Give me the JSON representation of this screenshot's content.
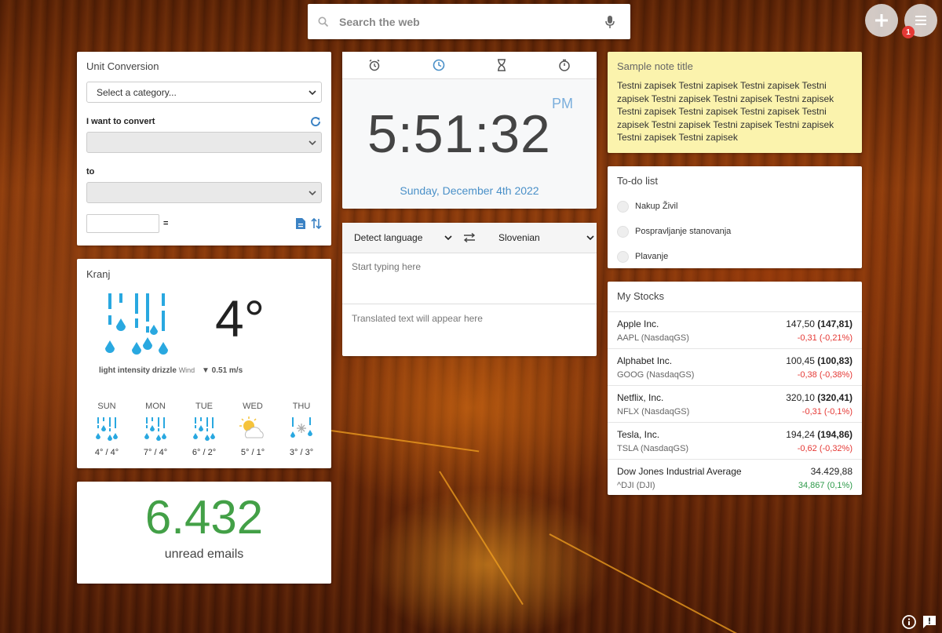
{
  "search": {
    "placeholder": "Search the web"
  },
  "header": {
    "notification_count": "1"
  },
  "unit_conversion": {
    "title": "Unit Conversion",
    "category_placeholder": "Select a category...",
    "convert_label": "I want to convert",
    "to_label": "to",
    "equals": "="
  },
  "weather": {
    "location": "Kranj",
    "temperature": "4°",
    "condition": "light intensity drizzle",
    "wind_label": "Wind",
    "wind_value": "0.51 m/s",
    "forecast": [
      {
        "day": "SUN",
        "temps": "4° / 4°",
        "icon": "rain-icon"
      },
      {
        "day": "MON",
        "temps": "7° / 4°",
        "icon": "rain-icon"
      },
      {
        "day": "TUE",
        "temps": "6° / 2°",
        "icon": "rain-icon"
      },
      {
        "day": "WED",
        "temps": "5° / 1°",
        "icon": "partly-sunny-icon"
      },
      {
        "day": "THU",
        "temps": "3° / 3°",
        "icon": "sleet-icon"
      }
    ]
  },
  "emails": {
    "count": "6.432",
    "label": "unread emails"
  },
  "clock": {
    "time": "5:51:32",
    "ampm": "PM",
    "date": "Sunday, December 4th 2022",
    "tabs": [
      "alarm-icon",
      "clock-icon",
      "hourglass-icon",
      "stopwatch-icon"
    ]
  },
  "translate": {
    "source_lang": "Detect language",
    "target_lang": "Slovenian",
    "input_placeholder": "Start typing here",
    "output_placeholder": "Translated text will appear here"
  },
  "note": {
    "title": "Sample note title",
    "body": "Testni zapisek Testni zapisek Testni zapisek Testni zapisek Testni zapisek Testni zapisek Testni zapisek Testni zapisek Testni zapisek Testni zapisek Testni zapisek Testni zapisek Testni zapisek Testni zapisek Testni zapisek Testni zapisek"
  },
  "todo": {
    "title": "To-do list",
    "items": [
      "Nakup Živil",
      "Pospravljanje stanovanja",
      "Plavanje"
    ]
  },
  "stocks": {
    "title": "My Stocks",
    "rows": [
      {
        "name": "Apple Inc.",
        "ticker": "AAPL (NasdaqGS)",
        "price": "147,50",
        "prev": "(147,81)",
        "change": "-0,31 (-0,21%)",
        "direction": "neg"
      },
      {
        "name": "Alphabet Inc.",
        "ticker": "GOOG (NasdaqGS)",
        "price": "100,45",
        "prev": "(100,83)",
        "change": "-0,38 (-0,38%)",
        "direction": "neg"
      },
      {
        "name": "Netflix, Inc.",
        "ticker": "NFLX (NasdaqGS)",
        "price": "320,10",
        "prev": "(320,41)",
        "change": "-0,31 (-0,1%)",
        "direction": "neg"
      },
      {
        "name": "Tesla, Inc.",
        "ticker": "TSLA (NasdaqGS)",
        "price": "194,24",
        "prev": "(194,86)",
        "change": "-0,62 (-0,32%)",
        "direction": "neg"
      },
      {
        "name": "Dow Jones Industrial Average",
        "ticker": "^DJI (DJI)",
        "price": "34.429,88",
        "prev": "",
        "change": "34,867 (0,1%)",
        "direction": "pos"
      }
    ]
  },
  "colors": {
    "accent_blue": "#4a90c8",
    "email_green": "#43a047",
    "negative": "#e53935",
    "positive": "#2e9a4a",
    "note_yellow": "#fbf3ad",
    "weather_blue": "#29a8e0"
  }
}
